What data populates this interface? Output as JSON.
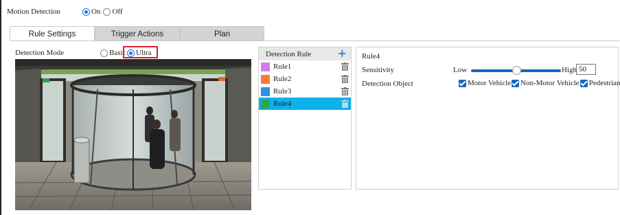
{
  "motion_detection": {
    "label": "Motion Detection",
    "options": [
      {
        "label": "On",
        "selected": true
      },
      {
        "label": "Off",
        "selected": false
      }
    ]
  },
  "tabs": [
    {
      "label": "Rule Settings",
      "active": true
    },
    {
      "label": "Trigger Actions",
      "active": false
    },
    {
      "label": "Plan",
      "active": false
    }
  ],
  "detection_mode": {
    "label": "Detection Mode",
    "options": [
      {
        "label": "Basic",
        "selected": false
      },
      {
        "label": "Ultra",
        "selected": true
      }
    ],
    "highlight_color": "#e0202a"
  },
  "rule_list": {
    "header": "Detection Rule",
    "add_icon": "plus-icon",
    "delete_icon": "trash-icon",
    "selected_color": "#10b0ea",
    "items": [
      {
        "label": "Rule1",
        "color": "#d37ee8",
        "selected": false
      },
      {
        "label": "Rule2",
        "color": "#f47a3a",
        "selected": false
      },
      {
        "label": "Rule3",
        "color": "#2f8fe6",
        "selected": false
      },
      {
        "label": "Rule4",
        "color": "#2aa84a",
        "selected": true
      }
    ]
  },
  "settings": {
    "title": "Rule4",
    "sensitivity": {
      "label": "Sensitivity",
      "low_label": "Low",
      "high_label": "High",
      "value": "50",
      "level": 0.5
    },
    "detection_object": {
      "label": "Detection Object",
      "options": [
        {
          "label": "Motor Vehicle",
          "checked": true
        },
        {
          "label": "Non-Motor Vehicle",
          "checked": true
        },
        {
          "label": "Pedestrian",
          "checked": true
        }
      ]
    }
  }
}
